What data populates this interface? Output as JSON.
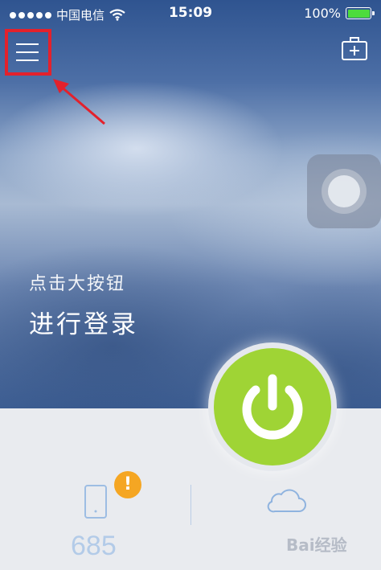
{
  "status_bar": {
    "carrier": "中国电信",
    "time": "15:09",
    "battery": "100%"
  },
  "hero": {
    "hint_line1": "点击大按钮",
    "hint_line2": "进行登录"
  },
  "footer": {
    "badge": "!",
    "device_count": "685",
    "watermark": "Bai经验"
  },
  "icons": [
    "menu-icon",
    "medical-kit-icon",
    "assistive-touch-icon",
    "power-icon",
    "phone-icon",
    "warning-icon",
    "cloud-icon"
  ],
  "colors": {
    "power_green": "#9fd435",
    "badge_orange": "#f5a623",
    "highlight_red": "#e3212c",
    "count_blue": "#b3cbe8"
  }
}
